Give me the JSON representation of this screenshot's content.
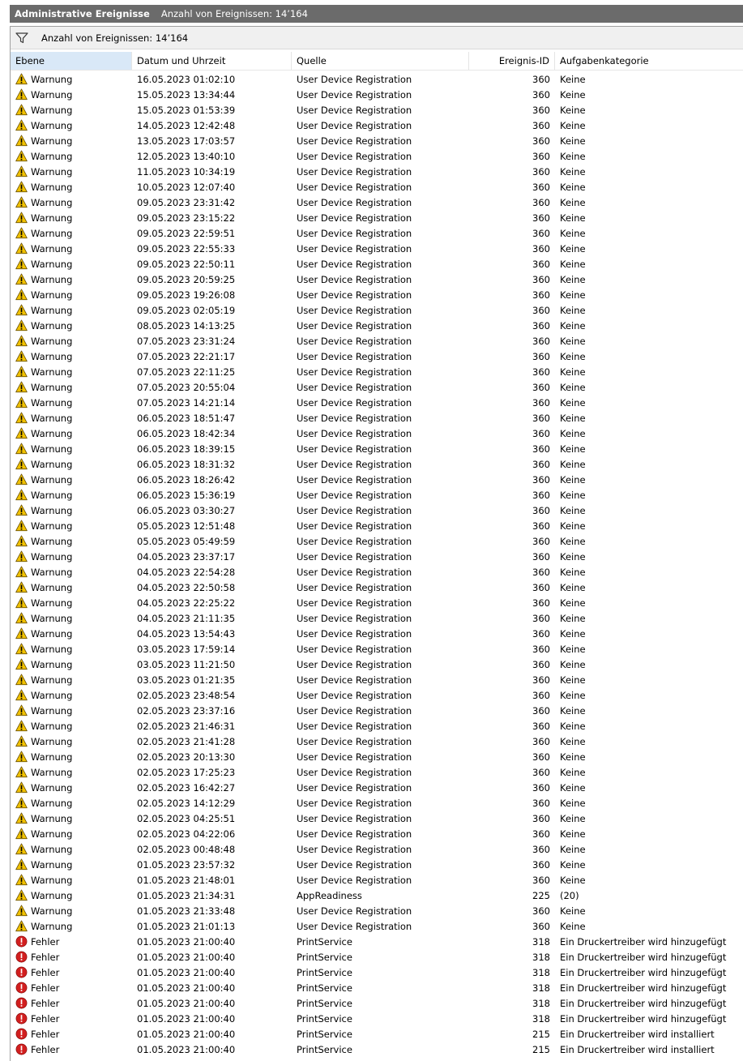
{
  "title": {
    "name": "Administrative Ereignisse",
    "count_text": "Anzahl von Ereignissen: 14’164"
  },
  "filter": {
    "icon": "filter-icon",
    "text": "Anzahl von Ereignissen: 14’164"
  },
  "columns": {
    "level": "Ebene",
    "date": "Datum und Uhrzeit",
    "source": "Quelle",
    "id": "Ereignis-ID",
    "category": "Aufgabenkategorie"
  },
  "icons": {
    "warning": "warning-icon",
    "error": "error-icon"
  },
  "colors": {
    "warning": "#f2c200",
    "error": "#d21f1f",
    "title_bg": "#6b6b6b",
    "selected_header": "#d9e8f7"
  },
  "rows": [
    {
      "level": "Warnung",
      "type": "warning",
      "date": "16.05.2023 01:02:10",
      "source": "User Device Registration",
      "id": "360",
      "category": "Keine"
    },
    {
      "level": "Warnung",
      "type": "warning",
      "date": "15.05.2023 13:34:44",
      "source": "User Device Registration",
      "id": "360",
      "category": "Keine"
    },
    {
      "level": "Warnung",
      "type": "warning",
      "date": "15.05.2023 01:53:39",
      "source": "User Device Registration",
      "id": "360",
      "category": "Keine"
    },
    {
      "level": "Warnung",
      "type": "warning",
      "date": "14.05.2023 12:42:48",
      "source": "User Device Registration",
      "id": "360",
      "category": "Keine"
    },
    {
      "level": "Warnung",
      "type": "warning",
      "date": "13.05.2023 17:03:57",
      "source": "User Device Registration",
      "id": "360",
      "category": "Keine"
    },
    {
      "level": "Warnung",
      "type": "warning",
      "date": "12.05.2023 13:40:10",
      "source": "User Device Registration",
      "id": "360",
      "category": "Keine"
    },
    {
      "level": "Warnung",
      "type": "warning",
      "date": "11.05.2023 10:34:19",
      "source": "User Device Registration",
      "id": "360",
      "category": "Keine"
    },
    {
      "level": "Warnung",
      "type": "warning",
      "date": "10.05.2023 12:07:40",
      "source": "User Device Registration",
      "id": "360",
      "category": "Keine"
    },
    {
      "level": "Warnung",
      "type": "warning",
      "date": "09.05.2023 23:31:42",
      "source": "User Device Registration",
      "id": "360",
      "category": "Keine"
    },
    {
      "level": "Warnung",
      "type": "warning",
      "date": "09.05.2023 23:15:22",
      "source": "User Device Registration",
      "id": "360",
      "category": "Keine"
    },
    {
      "level": "Warnung",
      "type": "warning",
      "date": "09.05.2023 22:59:51",
      "source": "User Device Registration",
      "id": "360",
      "category": "Keine"
    },
    {
      "level": "Warnung",
      "type": "warning",
      "date": "09.05.2023 22:55:33",
      "source": "User Device Registration",
      "id": "360",
      "category": "Keine"
    },
    {
      "level": "Warnung",
      "type": "warning",
      "date": "09.05.2023 22:50:11",
      "source": "User Device Registration",
      "id": "360",
      "category": "Keine"
    },
    {
      "level": "Warnung",
      "type": "warning",
      "date": "09.05.2023 20:59:25",
      "source": "User Device Registration",
      "id": "360",
      "category": "Keine"
    },
    {
      "level": "Warnung",
      "type": "warning",
      "date": "09.05.2023 19:26:08",
      "source": "User Device Registration",
      "id": "360",
      "category": "Keine"
    },
    {
      "level": "Warnung",
      "type": "warning",
      "date": "09.05.2023 02:05:19",
      "source": "User Device Registration",
      "id": "360",
      "category": "Keine"
    },
    {
      "level": "Warnung",
      "type": "warning",
      "date": "08.05.2023 14:13:25",
      "source": "User Device Registration",
      "id": "360",
      "category": "Keine"
    },
    {
      "level": "Warnung",
      "type": "warning",
      "date": "07.05.2023 23:31:24",
      "source": "User Device Registration",
      "id": "360",
      "category": "Keine"
    },
    {
      "level": "Warnung",
      "type": "warning",
      "date": "07.05.2023 22:21:17",
      "source": "User Device Registration",
      "id": "360",
      "category": "Keine"
    },
    {
      "level": "Warnung",
      "type": "warning",
      "date": "07.05.2023 22:11:25",
      "source": "User Device Registration",
      "id": "360",
      "category": "Keine"
    },
    {
      "level": "Warnung",
      "type": "warning",
      "date": "07.05.2023 20:55:04",
      "source": "User Device Registration",
      "id": "360",
      "category": "Keine"
    },
    {
      "level": "Warnung",
      "type": "warning",
      "date": "07.05.2023 14:21:14",
      "source": "User Device Registration",
      "id": "360",
      "category": "Keine"
    },
    {
      "level": "Warnung",
      "type": "warning",
      "date": "06.05.2023 18:51:47",
      "source": "User Device Registration",
      "id": "360",
      "category": "Keine"
    },
    {
      "level": "Warnung",
      "type": "warning",
      "date": "06.05.2023 18:42:34",
      "source": "User Device Registration",
      "id": "360",
      "category": "Keine"
    },
    {
      "level": "Warnung",
      "type": "warning",
      "date": "06.05.2023 18:39:15",
      "source": "User Device Registration",
      "id": "360",
      "category": "Keine"
    },
    {
      "level": "Warnung",
      "type": "warning",
      "date": "06.05.2023 18:31:32",
      "source": "User Device Registration",
      "id": "360",
      "category": "Keine"
    },
    {
      "level": "Warnung",
      "type": "warning",
      "date": "06.05.2023 18:26:42",
      "source": "User Device Registration",
      "id": "360",
      "category": "Keine"
    },
    {
      "level": "Warnung",
      "type": "warning",
      "date": "06.05.2023 15:36:19",
      "source": "User Device Registration",
      "id": "360",
      "category": "Keine"
    },
    {
      "level": "Warnung",
      "type": "warning",
      "date": "06.05.2023 03:30:27",
      "source": "User Device Registration",
      "id": "360",
      "category": "Keine"
    },
    {
      "level": "Warnung",
      "type": "warning",
      "date": "05.05.2023 12:51:48",
      "source": "User Device Registration",
      "id": "360",
      "category": "Keine"
    },
    {
      "level": "Warnung",
      "type": "warning",
      "date": "05.05.2023 05:49:59",
      "source": "User Device Registration",
      "id": "360",
      "category": "Keine"
    },
    {
      "level": "Warnung",
      "type": "warning",
      "date": "04.05.2023 23:37:17",
      "source": "User Device Registration",
      "id": "360",
      "category": "Keine"
    },
    {
      "level": "Warnung",
      "type": "warning",
      "date": "04.05.2023 22:54:28",
      "source": "User Device Registration",
      "id": "360",
      "category": "Keine"
    },
    {
      "level": "Warnung",
      "type": "warning",
      "date": "04.05.2023 22:50:58",
      "source": "User Device Registration",
      "id": "360",
      "category": "Keine"
    },
    {
      "level": "Warnung",
      "type": "warning",
      "date": "04.05.2023 22:25:22",
      "source": "User Device Registration",
      "id": "360",
      "category": "Keine"
    },
    {
      "level": "Warnung",
      "type": "warning",
      "date": "04.05.2023 21:11:35",
      "source": "User Device Registration",
      "id": "360",
      "category": "Keine"
    },
    {
      "level": "Warnung",
      "type": "warning",
      "date": "04.05.2023 13:54:43",
      "source": "User Device Registration",
      "id": "360",
      "category": "Keine"
    },
    {
      "level": "Warnung",
      "type": "warning",
      "date": "03.05.2023 17:59:14",
      "source": "User Device Registration",
      "id": "360",
      "category": "Keine"
    },
    {
      "level": "Warnung",
      "type": "warning",
      "date": "03.05.2023 11:21:50",
      "source": "User Device Registration",
      "id": "360",
      "category": "Keine"
    },
    {
      "level": "Warnung",
      "type": "warning",
      "date": "03.05.2023 01:21:35",
      "source": "User Device Registration",
      "id": "360",
      "category": "Keine"
    },
    {
      "level": "Warnung",
      "type": "warning",
      "date": "02.05.2023 23:48:54",
      "source": "User Device Registration",
      "id": "360",
      "category": "Keine"
    },
    {
      "level": "Warnung",
      "type": "warning",
      "date": "02.05.2023 23:37:16",
      "source": "User Device Registration",
      "id": "360",
      "category": "Keine"
    },
    {
      "level": "Warnung",
      "type": "warning",
      "date": "02.05.2023 21:46:31",
      "source": "User Device Registration",
      "id": "360",
      "category": "Keine"
    },
    {
      "level": "Warnung",
      "type": "warning",
      "date": "02.05.2023 21:41:28",
      "source": "User Device Registration",
      "id": "360",
      "category": "Keine"
    },
    {
      "level": "Warnung",
      "type": "warning",
      "date": "02.05.2023 20:13:30",
      "source": "User Device Registration",
      "id": "360",
      "category": "Keine"
    },
    {
      "level": "Warnung",
      "type": "warning",
      "date": "02.05.2023 17:25:23",
      "source": "User Device Registration",
      "id": "360",
      "category": "Keine"
    },
    {
      "level": "Warnung",
      "type": "warning",
      "date": "02.05.2023 16:42:27",
      "source": "User Device Registration",
      "id": "360",
      "category": "Keine"
    },
    {
      "level": "Warnung",
      "type": "warning",
      "date": "02.05.2023 14:12:29",
      "source": "User Device Registration",
      "id": "360",
      "category": "Keine"
    },
    {
      "level": "Warnung",
      "type": "warning",
      "date": "02.05.2023 04:25:51",
      "source": "User Device Registration",
      "id": "360",
      "category": "Keine"
    },
    {
      "level": "Warnung",
      "type": "warning",
      "date": "02.05.2023 04:22:06",
      "source": "User Device Registration",
      "id": "360",
      "category": "Keine"
    },
    {
      "level": "Warnung",
      "type": "warning",
      "date": "02.05.2023 00:48:48",
      "source": "User Device Registration",
      "id": "360",
      "category": "Keine"
    },
    {
      "level": "Warnung",
      "type": "warning",
      "date": "01.05.2023 23:57:32",
      "source": "User Device Registration",
      "id": "360",
      "category": "Keine"
    },
    {
      "level": "Warnung",
      "type": "warning",
      "date": "01.05.2023 21:48:01",
      "source": "User Device Registration",
      "id": "360",
      "category": "Keine"
    },
    {
      "level": "Warnung",
      "type": "warning",
      "date": "01.05.2023 21:34:31",
      "source": "AppReadiness",
      "id": "225",
      "category": "(20)"
    },
    {
      "level": "Warnung",
      "type": "warning",
      "date": "01.05.2023 21:33:48",
      "source": "User Device Registration",
      "id": "360",
      "category": "Keine"
    },
    {
      "level": "Warnung",
      "type": "warning",
      "date": "01.05.2023 21:01:13",
      "source": "User Device Registration",
      "id": "360",
      "category": "Keine"
    },
    {
      "level": "Fehler",
      "type": "error",
      "date": "01.05.2023 21:00:40",
      "source": "PrintService",
      "id": "318",
      "category": "Ein Druckertreiber wird hinzugefügt"
    },
    {
      "level": "Fehler",
      "type": "error",
      "date": "01.05.2023 21:00:40",
      "source": "PrintService",
      "id": "318",
      "category": "Ein Druckertreiber wird hinzugefügt"
    },
    {
      "level": "Fehler",
      "type": "error",
      "date": "01.05.2023 21:00:40",
      "source": "PrintService",
      "id": "318",
      "category": "Ein Druckertreiber wird hinzugefügt"
    },
    {
      "level": "Fehler",
      "type": "error",
      "date": "01.05.2023 21:00:40",
      "source": "PrintService",
      "id": "318",
      "category": "Ein Druckertreiber wird hinzugefügt"
    },
    {
      "level": "Fehler",
      "type": "error",
      "date": "01.05.2023 21:00:40",
      "source": "PrintService",
      "id": "318",
      "category": "Ein Druckertreiber wird hinzugefügt"
    },
    {
      "level": "Fehler",
      "type": "error",
      "date": "01.05.2023 21:00:40",
      "source": "PrintService",
      "id": "318",
      "category": "Ein Druckertreiber wird hinzugefügt"
    },
    {
      "level": "Fehler",
      "type": "error",
      "date": "01.05.2023 21:00:40",
      "source": "PrintService",
      "id": "215",
      "category": "Ein Druckertreiber wird installiert"
    },
    {
      "level": "Fehler",
      "type": "error",
      "date": "01.05.2023 21:00:40",
      "source": "PrintService",
      "id": "215",
      "category": "Ein Druckertreiber wird installiert"
    }
  ]
}
